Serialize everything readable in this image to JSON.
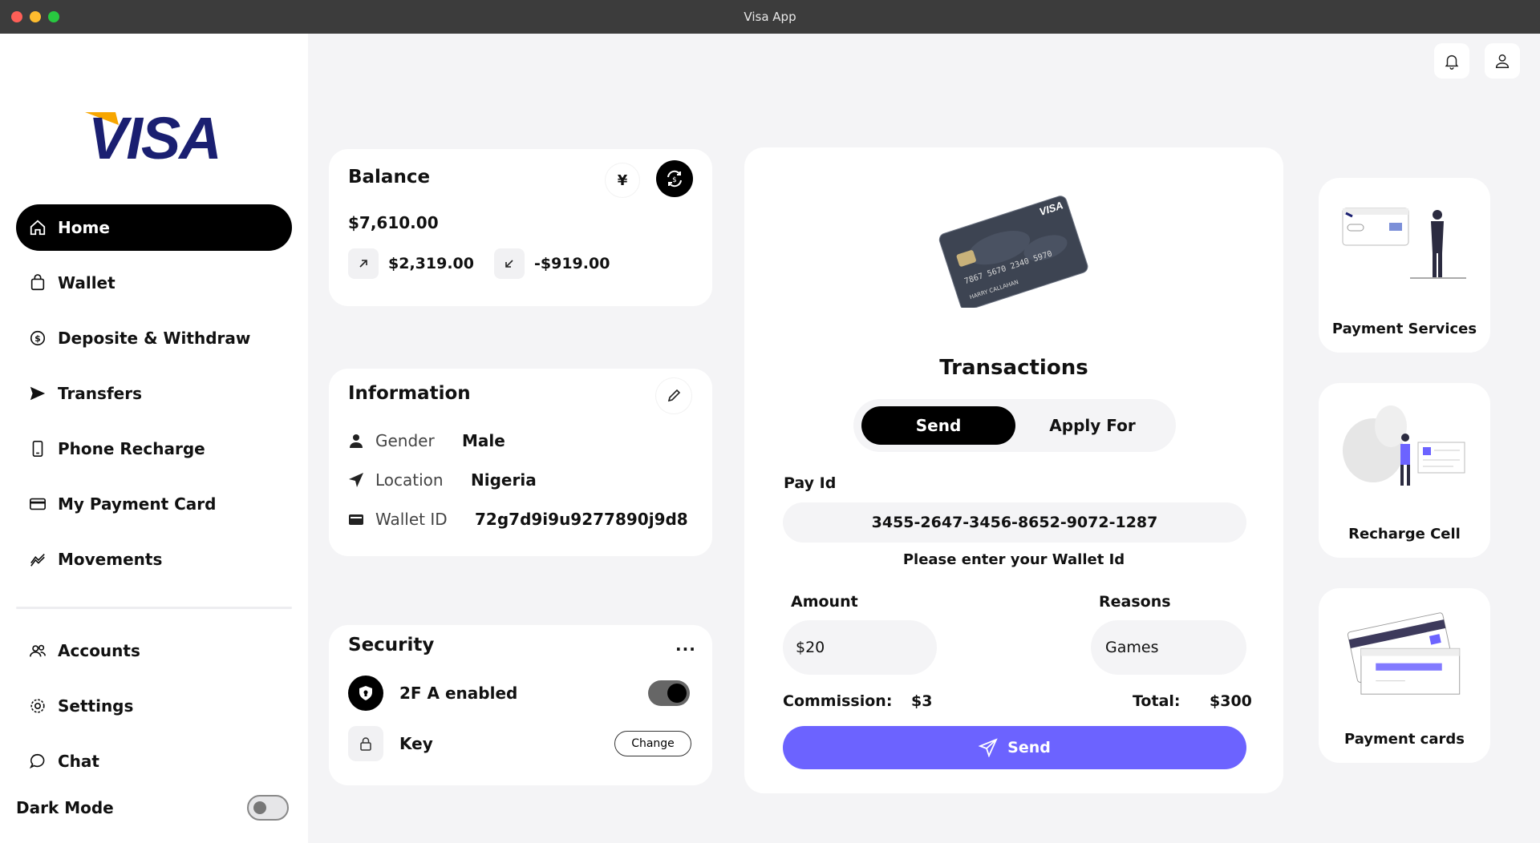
{
  "window": {
    "title": "Visa App"
  },
  "brand": {
    "name": "VISA",
    "primary": "#1a1f71",
    "accent": "#f7a600"
  },
  "sidebar": {
    "items": [
      {
        "label": "Home",
        "icon": "home-icon",
        "active": true
      },
      {
        "label": "Wallet",
        "icon": "bag-icon"
      },
      {
        "label": "Deposite & Withdraw",
        "icon": "dollar-circle-icon"
      },
      {
        "label": "Transfers",
        "icon": "send-icon"
      },
      {
        "label": "Phone Recharge",
        "icon": "phone-icon"
      },
      {
        "label": "My Payment Card",
        "icon": "card-icon"
      },
      {
        "label": "Movements",
        "icon": "activity-icon"
      },
      {
        "label": "Accounts",
        "icon": "users-icon"
      },
      {
        "label": "Settings",
        "icon": "gear-icon"
      },
      {
        "label": "Chat",
        "icon": "chat-icon"
      }
    ],
    "dark_mode": {
      "label": "Dark Mode",
      "enabled": false
    }
  },
  "balance": {
    "title": "Balance",
    "currency_symbol": "¥",
    "amount": "$7,610.00",
    "income": "$2,319.00",
    "expense": "-$919.00"
  },
  "information": {
    "title": "Information",
    "gender_label": "Gender",
    "gender": "Male",
    "location_label": "Location",
    "location": "Nigeria",
    "wallet_label": "Wallet ID",
    "wallet_id": "72g7d9i9u9277890j9d8"
  },
  "security": {
    "title": "Security",
    "twofa_label": "2F A enabled",
    "twofa_enabled": true,
    "key_label": "Key",
    "change_label": "Change"
  },
  "transactions": {
    "title": "Transactions",
    "card_brand": "VISA",
    "card_number": "7867 5670 2340 5970",
    "card_holder": "HARRY CALLAHAN",
    "tabs": [
      "Send",
      "Apply For"
    ],
    "pay_id_label": "Pay Id",
    "pay_id": "3455-2647-3456-8652-9072-1287",
    "hint": "Please enter your Wallet Id",
    "amount_label": "Amount",
    "amount": "$20",
    "reasons_label": "Reasons",
    "reason": "Games",
    "commission_label": "Commission:",
    "commission": "$3",
    "total_label": "Total:",
    "total": "$300",
    "send_label": "Send",
    "accent": "#6c63ff"
  },
  "services": [
    {
      "label": "Payment Services"
    },
    {
      "label": "Recharge Cell"
    },
    {
      "label": "Payment cards"
    }
  ]
}
